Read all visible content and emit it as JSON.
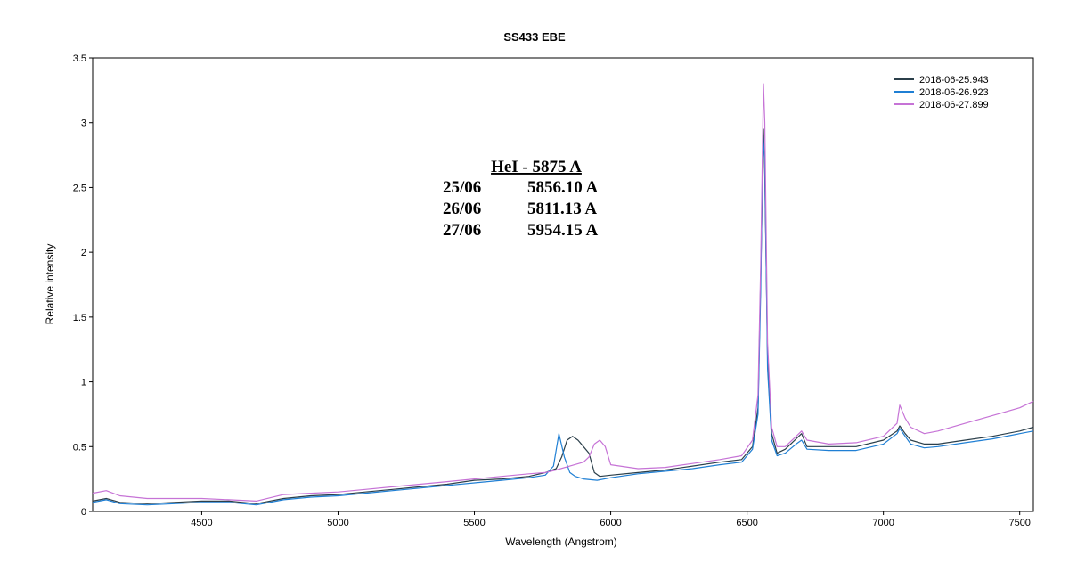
{
  "chart_data": {
    "type": "line",
    "title": "SS433   EBE",
    "xlabel": "Wavelength (Angstrom)",
    "ylabel": "Relative intensity",
    "xlim": [
      4100,
      7550
    ],
    "ylim": [
      0,
      3.5
    ],
    "xticks": [
      4500,
      5000,
      5500,
      6000,
      6500,
      7000,
      7500
    ],
    "yticks": [
      0,
      0.5,
      1,
      1.5,
      2,
      2.5,
      3,
      3.5
    ],
    "ytick_labels": [
      "0",
      "0.5",
      "1",
      "1.5",
      "2",
      "2.5",
      "3",
      "3.5"
    ],
    "grid": false,
    "legend_position": "top-right",
    "series": [
      {
        "name": "2018-06-25.943",
        "color": "#2b3f4a",
        "x": [
          4100,
          4150,
          4200,
          4300,
          4400,
          4500,
          4600,
          4700,
          4800,
          4900,
          5000,
          5100,
          5200,
          5300,
          5400,
          5500,
          5600,
          5700,
          5760,
          5800,
          5820,
          5840,
          5860,
          5880,
          5900,
          5920,
          5940,
          5960,
          6000,
          6100,
          6200,
          6300,
          6400,
          6480,
          6520,
          6540,
          6550,
          6560,
          6565,
          6575,
          6590,
          6610,
          6640,
          6680,
          6700,
          6720,
          6800,
          6900,
          7000,
          7050,
          7060,
          7080,
          7100,
          7150,
          7200,
          7300,
          7400,
          7500,
          7550
        ],
        "y": [
          0.08,
          0.1,
          0.07,
          0.06,
          0.07,
          0.08,
          0.08,
          0.06,
          0.1,
          0.12,
          0.13,
          0.15,
          0.17,
          0.19,
          0.21,
          0.24,
          0.25,
          0.27,
          0.3,
          0.33,
          0.42,
          0.55,
          0.58,
          0.55,
          0.5,
          0.45,
          0.3,
          0.27,
          0.28,
          0.3,
          0.32,
          0.35,
          0.38,
          0.4,
          0.5,
          0.8,
          1.8,
          2.95,
          2.6,
          1.2,
          0.6,
          0.45,
          0.48,
          0.56,
          0.6,
          0.5,
          0.5,
          0.5,
          0.55,
          0.62,
          0.66,
          0.6,
          0.55,
          0.52,
          0.52,
          0.55,
          0.58,
          0.62,
          0.65
        ]
      },
      {
        "name": "2018-06-26.923",
        "color": "#1f7fd4",
        "x": [
          4100,
          4150,
          4200,
          4300,
          4400,
          4500,
          4600,
          4700,
          4800,
          4900,
          5000,
          5100,
          5200,
          5300,
          5400,
          5500,
          5600,
          5700,
          5760,
          5790,
          5810,
          5830,
          5850,
          5870,
          5900,
          5950,
          6000,
          6100,
          6200,
          6300,
          6400,
          6480,
          6520,
          6540,
          6550,
          6558,
          6565,
          6575,
          6590,
          6610,
          6640,
          6680,
          6700,
          6720,
          6800,
          6900,
          7000,
          7050,
          7060,
          7080,
          7100,
          7150,
          7200,
          7300,
          7400,
          7500,
          7550
        ],
        "y": [
          0.07,
          0.09,
          0.06,
          0.05,
          0.06,
          0.07,
          0.07,
          0.05,
          0.09,
          0.11,
          0.12,
          0.14,
          0.16,
          0.18,
          0.2,
          0.22,
          0.24,
          0.26,
          0.28,
          0.35,
          0.6,
          0.42,
          0.3,
          0.27,
          0.25,
          0.24,
          0.26,
          0.29,
          0.31,
          0.33,
          0.36,
          0.38,
          0.48,
          0.75,
          1.7,
          2.9,
          2.7,
          1.1,
          0.55,
          0.43,
          0.45,
          0.52,
          0.55,
          0.48,
          0.47,
          0.47,
          0.52,
          0.6,
          0.64,
          0.58,
          0.52,
          0.49,
          0.5,
          0.53,
          0.56,
          0.6,
          0.62
        ]
      },
      {
        "name": "2018-06-27.899",
        "color": "#c673d6",
        "x": [
          4100,
          4150,
          4200,
          4300,
          4400,
          4500,
          4600,
          4700,
          4800,
          4900,
          5000,
          5100,
          5200,
          5300,
          5400,
          5500,
          5600,
          5700,
          5760,
          5800,
          5850,
          5900,
          5920,
          5940,
          5960,
          5980,
          6000,
          6100,
          6200,
          6300,
          6400,
          6480,
          6520,
          6540,
          6550,
          6560,
          6565,
          6575,
          6590,
          6610,
          6640,
          6680,
          6700,
          6720,
          6800,
          6900,
          7000,
          7050,
          7060,
          7080,
          7100,
          7150,
          7200,
          7300,
          7400,
          7500,
          7550
        ],
        "y": [
          0.14,
          0.16,
          0.12,
          0.1,
          0.1,
          0.1,
          0.09,
          0.08,
          0.13,
          0.14,
          0.15,
          0.17,
          0.19,
          0.21,
          0.23,
          0.25,
          0.27,
          0.29,
          0.3,
          0.32,
          0.35,
          0.38,
          0.42,
          0.52,
          0.55,
          0.5,
          0.36,
          0.33,
          0.34,
          0.37,
          0.4,
          0.43,
          0.55,
          0.9,
          1.9,
          3.3,
          3.0,
          1.3,
          0.65,
          0.5,
          0.5,
          0.58,
          0.62,
          0.55,
          0.52,
          0.53,
          0.58,
          0.68,
          0.82,
          0.72,
          0.65,
          0.6,
          0.62,
          0.68,
          0.74,
          0.8,
          0.85
        ]
      }
    ],
    "annotations": {
      "title": "HeI - 5875 A",
      "rows": [
        {
          "date": "25/06",
          "value": "5856.10 A"
        },
        {
          "date": "26/06",
          "value": "5811.13 A"
        },
        {
          "date": "27/06",
          "value": "5954.15 A"
        }
      ]
    }
  }
}
